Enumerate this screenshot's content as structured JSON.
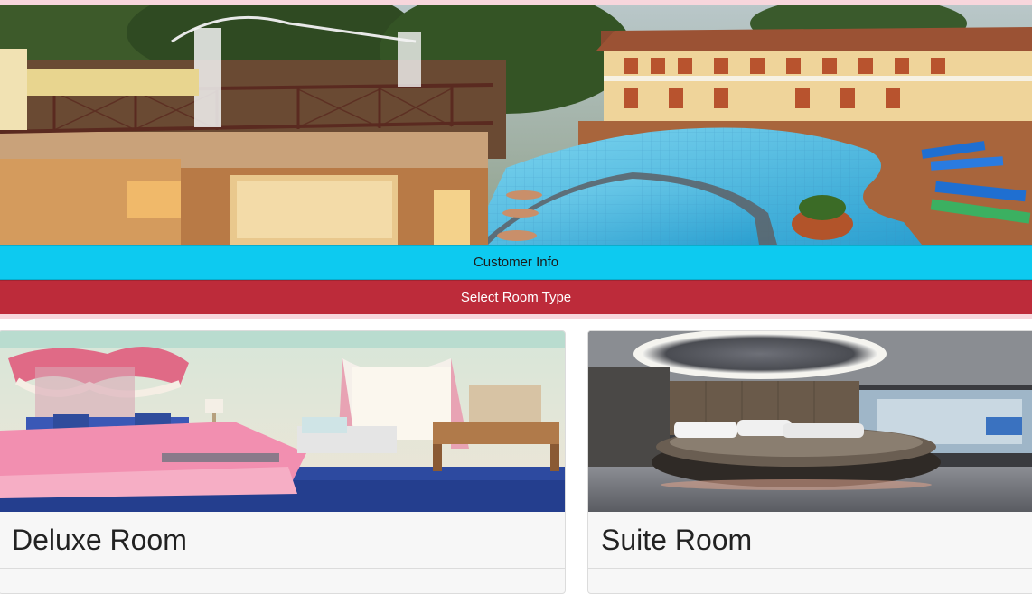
{
  "hero": {
    "image": "resort-pool-image"
  },
  "nav": {
    "customer_info_label": "Customer Info",
    "select_room_label": "Select Room Type"
  },
  "colors": {
    "info_bar": "#0dcaf0",
    "room_bar": "#bd2b3a",
    "accent_strip": "#f7d6dc"
  },
  "rooms": [
    {
      "title": "Deluxe Room",
      "image": "deluxe-bedroom-image"
    },
    {
      "title": "Suite Room",
      "image": "suite-bedroom-image"
    }
  ]
}
